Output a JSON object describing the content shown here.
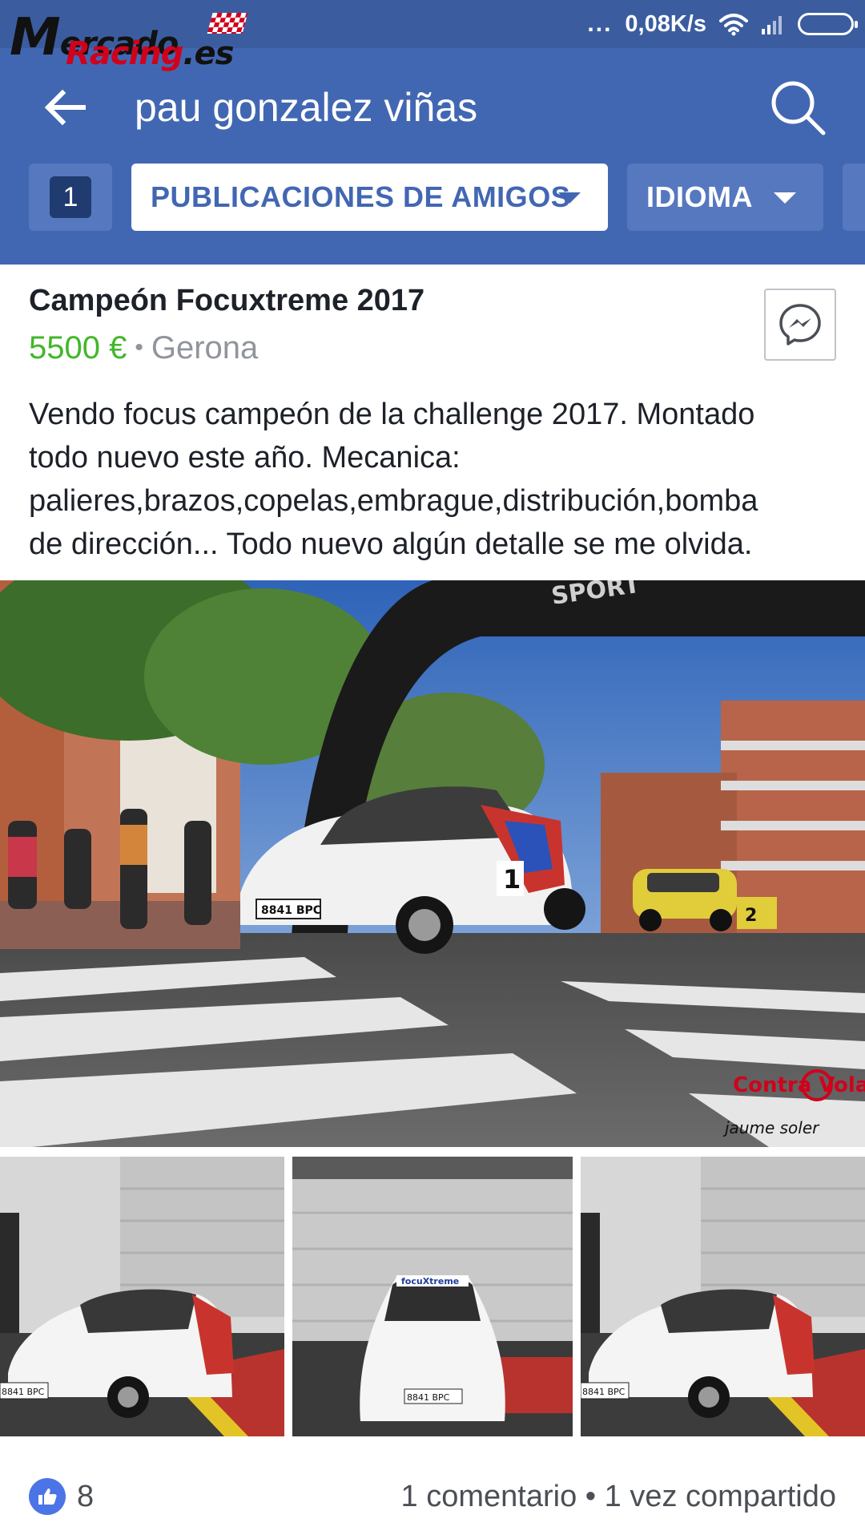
{
  "status_bar": {
    "dots": "...",
    "network_speed": "0,08K/s",
    "icons": [
      "wifi-icon",
      "signal-icon",
      "battery-icon"
    ]
  },
  "watermark": {
    "line1_big": "M",
    "line1_rest": "ercado",
    "line2": "Racing",
    "line2_suffix": ".es"
  },
  "header": {
    "back_icon": "arrow-left-icon",
    "search_query": "pau gonzalez viñas",
    "search_icon": "search-icon"
  },
  "filters": {
    "count": "1",
    "items": [
      {
        "label": "PUBLICACIONES DE AMIGOS",
        "active": true
      },
      {
        "label": "IDIOMA",
        "active": false
      }
    ]
  },
  "post": {
    "title": "Campeón Focuxtreme 2017",
    "price": "5500 €",
    "separator": "•",
    "location": "Gerona",
    "messenger_icon": "messenger-icon",
    "description": "Vendo focus campeón de la challenge 2017. Montado\ntodo nuevo este año. Mecanica:\npalieres,brazos,copelas,embrague,distribución,bomba\nde dirección... Todo nuevo algún detalle se me olvida."
  },
  "main_photo": {
    "car_plate": "8841 BPC",
    "car_number": "1",
    "second_car_number": "2",
    "arch_text": "SPORT",
    "photo_credit": "Contra Volant",
    "photographer": "jaume soler"
  },
  "thumbnails": [
    {
      "plate": "8841 BPC"
    },
    {
      "plate": "8841 BPC",
      "windshield": "focuXtreme"
    },
    {
      "plate": "8841 BPC"
    }
  ],
  "footer": {
    "like_icon": "thumbs-up-icon",
    "likes": "8",
    "stats": "1 comentario • 1 vez compartido"
  },
  "colors": {
    "header": "#4267b2",
    "status_bar": "#3b5da0",
    "price": "#42b72a",
    "secondary_text": "#90949c"
  }
}
